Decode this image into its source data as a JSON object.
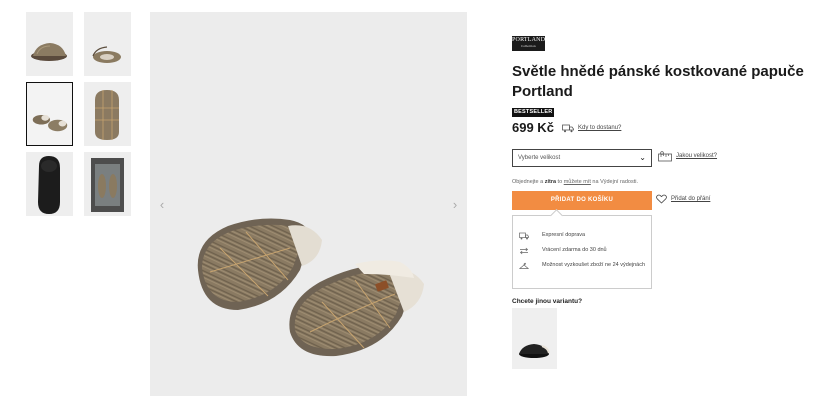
{
  "gallery": {
    "thumbnails": [
      {
        "id": "thumb-1",
        "icon": "slippers-side-view"
      },
      {
        "id": "thumb-2",
        "icon": "slippers-top-view"
      },
      {
        "id": "thumb-3",
        "icon": "slippers-pair-view",
        "active": true
      },
      {
        "id": "thumb-4",
        "icon": "slippers-top-view"
      },
      {
        "id": "thumb-5",
        "icon": "slipper-sole-view"
      },
      {
        "id": "thumb-6",
        "icon": "slippers-in-box"
      }
    ],
    "prev_arrow": "‹",
    "next_arrow": "›"
  },
  "product": {
    "brand": "PORTLAND",
    "brand_sub": "Collection",
    "title": "Světle hnědé pánské kostkované papuče Portland",
    "badge": "BESTSELLER",
    "price": "699 Kč",
    "delivery_link": "Kdy to dostanu?"
  },
  "size": {
    "placeholder": "Vyberte velikost",
    "chevron": "⌄",
    "size_link": "Jakou velikost?"
  },
  "pickup": {
    "text_1": "Objednejte a ",
    "bold": "zítra",
    "text_2": " to ",
    "link": "můžete mít",
    "text_3": " na Výdejní radosti."
  },
  "cart": {
    "button_label": "PŘIDAT DO KOŠÍKU",
    "wishlist_link": "Přidat do přání"
  },
  "benefits": [
    {
      "icon": "truck-icon",
      "text": "Expresní doprava"
    },
    {
      "icon": "return-arrows-icon",
      "text": "Vrácení zdarma do 30 dnů"
    },
    {
      "icon": "hanger-icon",
      "text": "Možnost vyzkoušet zboží ne 24 výdejnách"
    }
  ],
  "variants": {
    "title": "Chcete jinou variantu?"
  },
  "colors": {
    "accent": "#f28c42",
    "badge_bg": "#111111"
  }
}
